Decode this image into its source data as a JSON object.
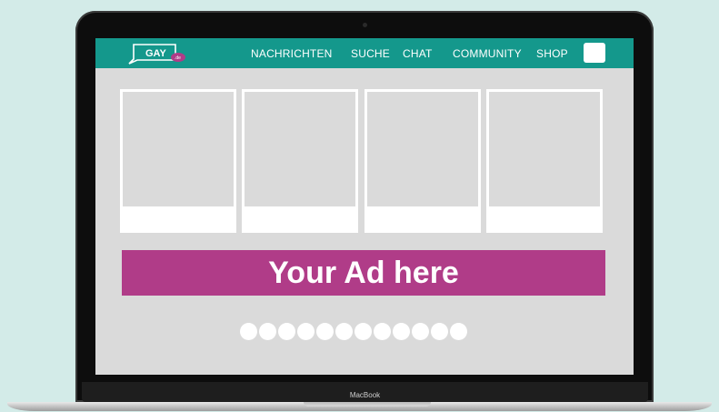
{
  "header": {
    "logo_text": "GAY",
    "logo_badge": ".de",
    "nav_items": [
      "NACHRICHTEN",
      "SUCHE",
      "CHAT",
      "COMMUNITY",
      "SHOP"
    ]
  },
  "cards": [
    {
      "placeholder": true
    },
    {
      "placeholder": true
    },
    {
      "placeholder": true
    },
    {
      "placeholder": true
    }
  ],
  "ad": {
    "text": "Your Ad here",
    "color": "#b03c88"
  },
  "pagination": {
    "dot_count": 12
  },
  "device": {
    "model_label": "MacBook"
  },
  "colors": {
    "nav_bg": "#14988c",
    "page_bg": "#d3ebe8",
    "screen_bg": "#dadada"
  }
}
